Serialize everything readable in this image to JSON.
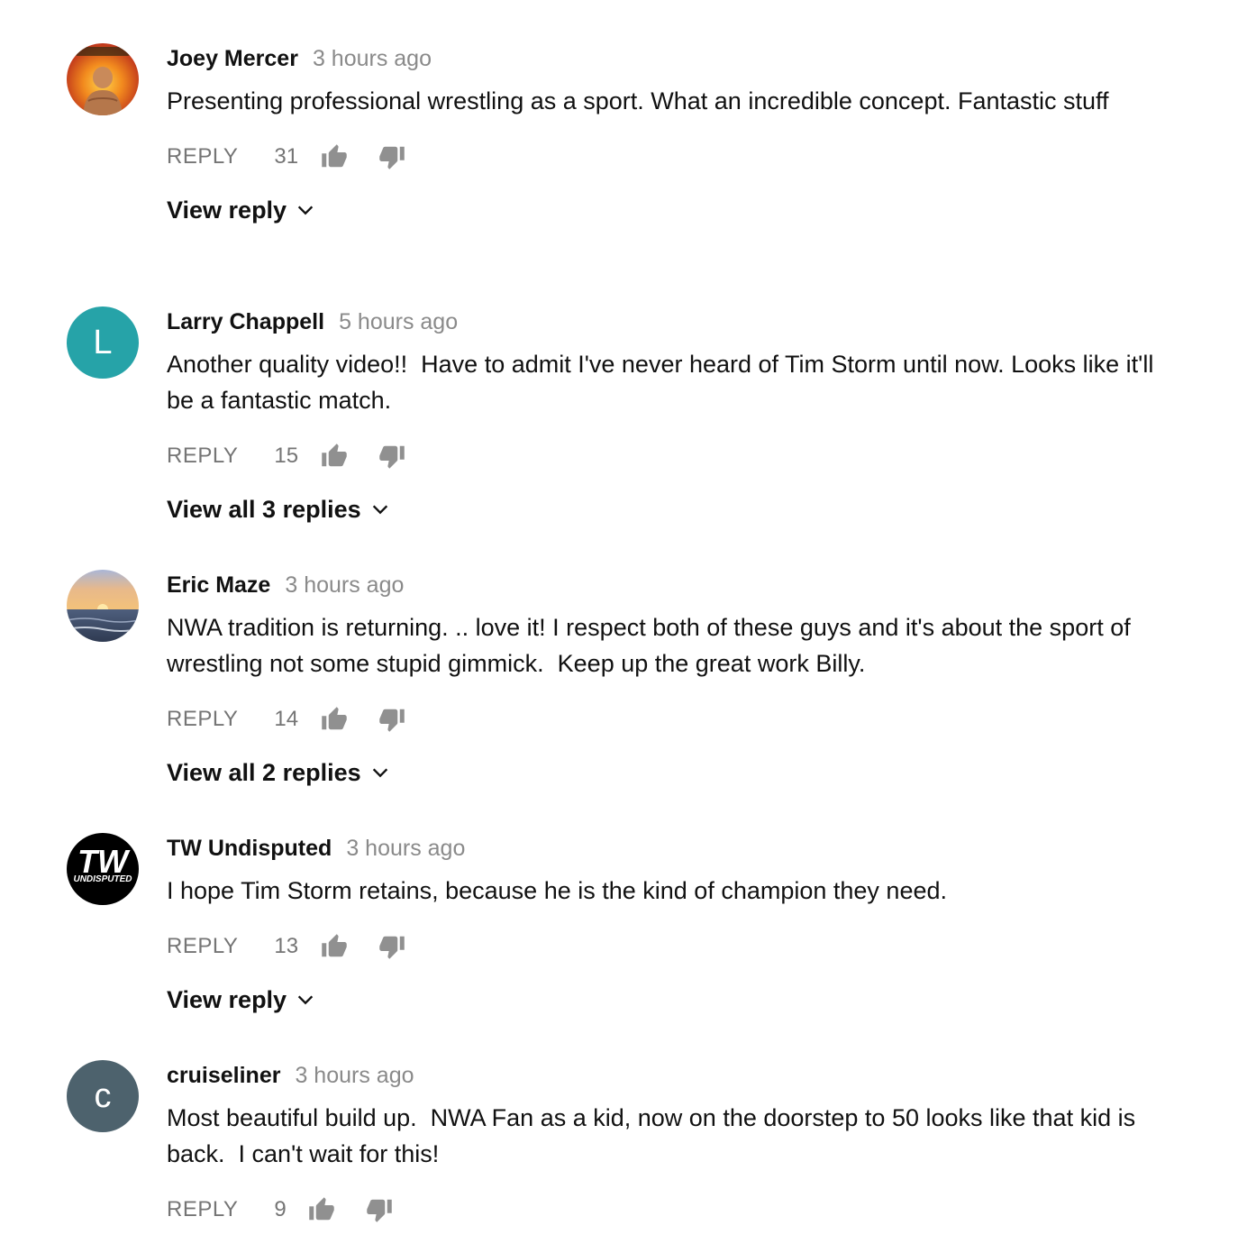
{
  "colors": {
    "author": "#111111",
    "timestamp": "#8a8a8a",
    "action": "#757575",
    "avatar_larry": "#26a3a8",
    "avatar_cruiseliner": "#4d626d"
  },
  "labels": {
    "reply": "REPLY"
  },
  "comments": [
    {
      "author": "Joey Mercer",
      "time": "3 hours ago",
      "text": "Presenting professional wrestling as a sport. What an incredible concept. Fantastic stuff",
      "likes": "31",
      "avatar_type": "image",
      "view_replies": "View reply"
    },
    {
      "author": "Larry Chappell",
      "time": "5 hours ago",
      "text": "Another quality video!!  Have to admit I've never heard of Tim Storm until now. Looks like it'll be a fantastic match.",
      "likes": "15",
      "avatar_type": "letter",
      "avatar_letter": "L",
      "view_replies": "View all 3 replies"
    },
    {
      "author": "Eric Maze",
      "time": "3 hours ago",
      "text": "NWA tradition is returning. .. love it! I respect both of these guys and it's about the sport of wrestling not some stupid gimmick.  Keep up the great work Billy.",
      "likes": "14",
      "avatar_type": "image",
      "view_replies": "View all 2 replies"
    },
    {
      "author": "TW Undisputed",
      "time": "3 hours ago",
      "text": "I hope Tim Storm retains, because he is the kind of champion they need.",
      "likes": "13",
      "avatar_type": "logo",
      "avatar_logo_text": "TW",
      "avatar_logo_subtext": "UNDISPUTED",
      "view_replies": "View reply"
    },
    {
      "author": "cruiseliner",
      "time": "3 hours ago",
      "text": "Most beautiful build up.  NWA Fan as a kid, now on the doorstep to 50 looks like that kid is back.  I can't wait for this!",
      "likes": "9",
      "avatar_type": "letter",
      "avatar_letter": "c"
    }
  ]
}
